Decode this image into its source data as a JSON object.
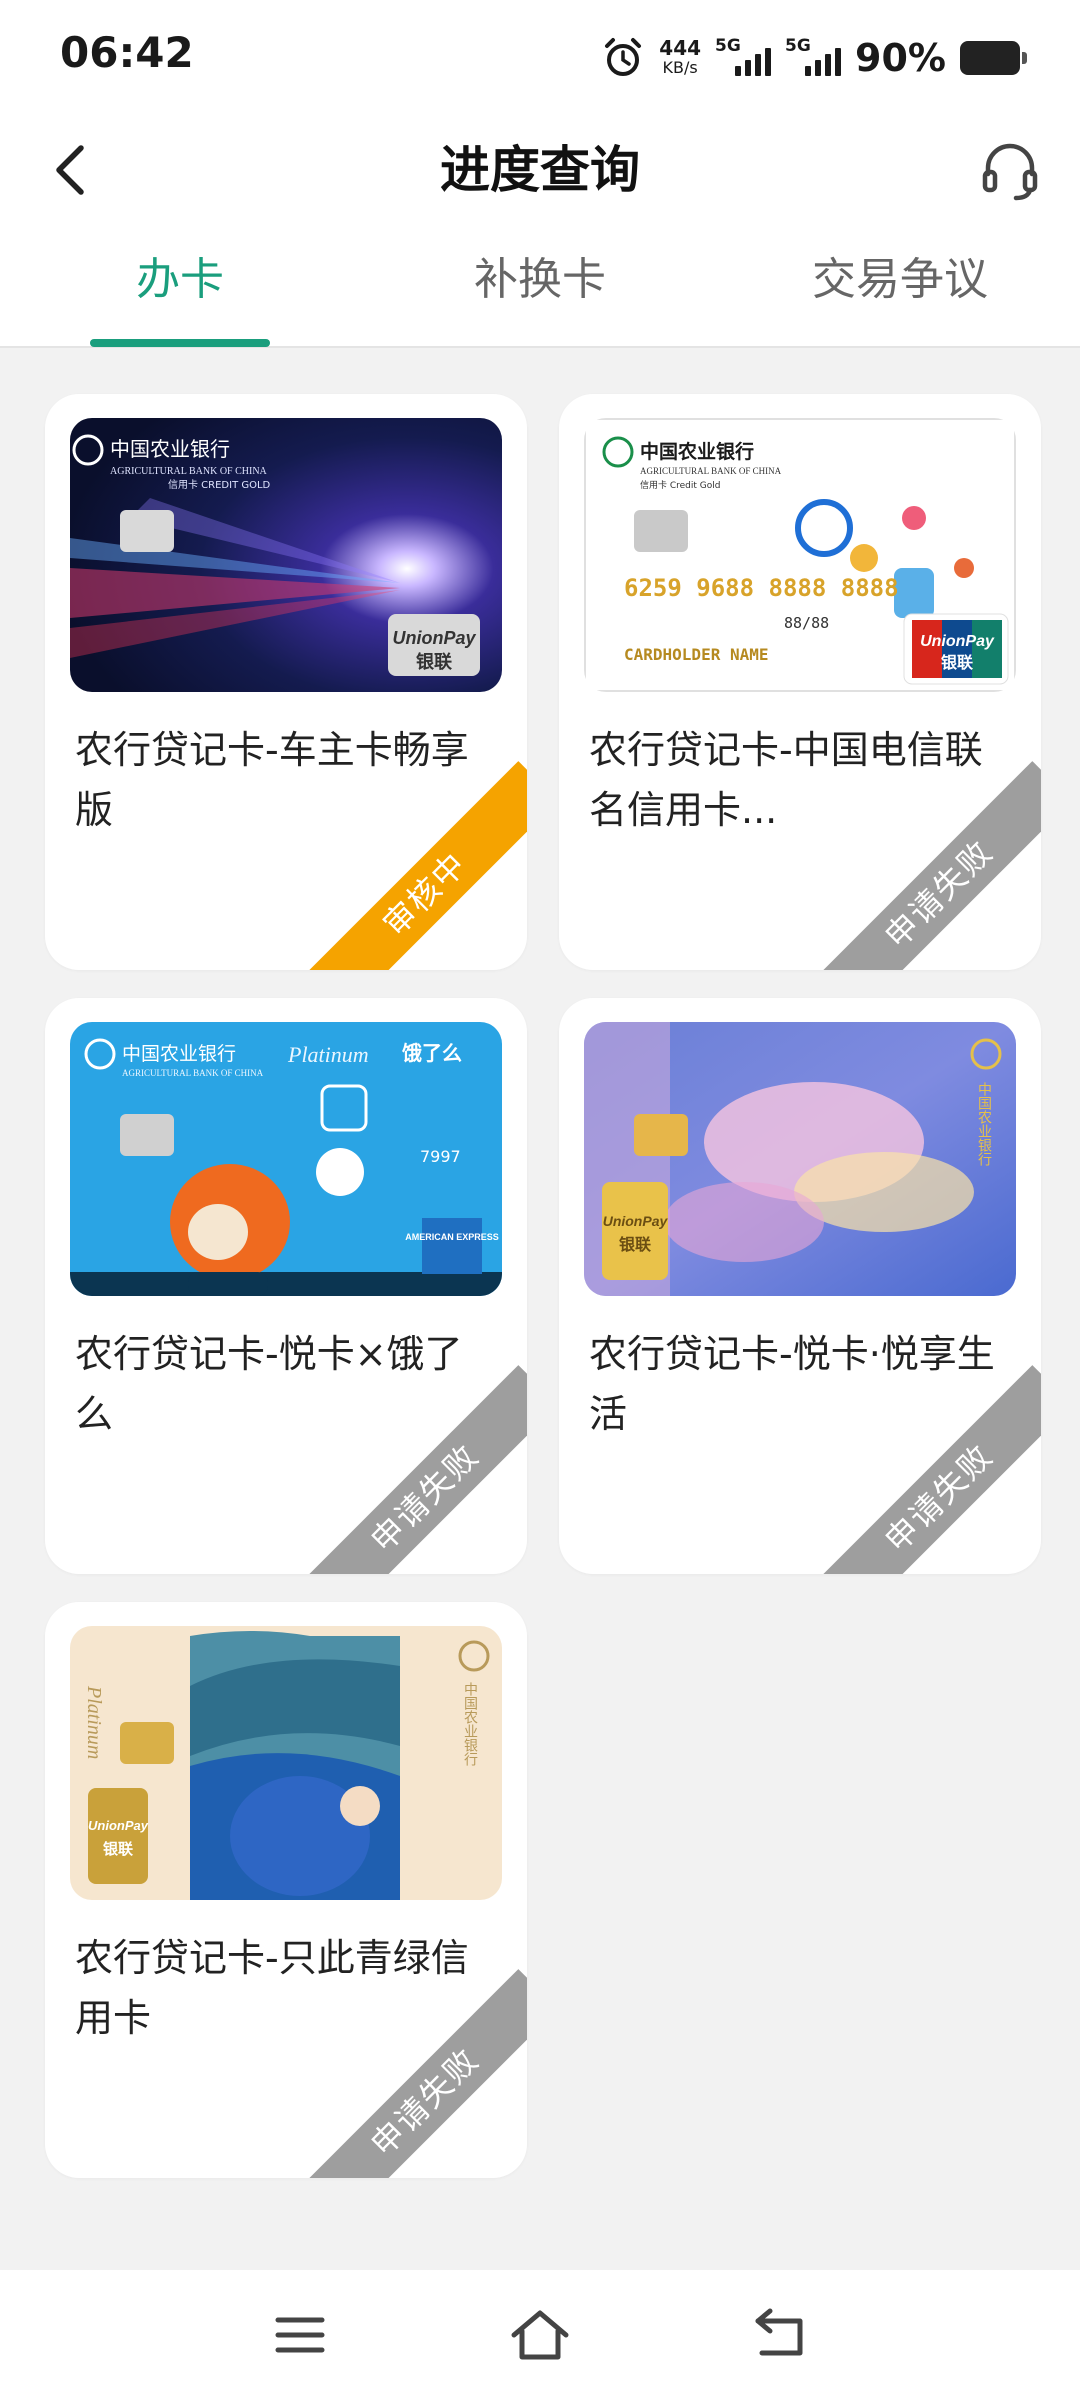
{
  "status_bar": {
    "time": "06:42",
    "net_speed_value": "444",
    "net_speed_unit": "KB/s",
    "sim1_tag": "5G",
    "sim2_tag": "5G",
    "battery": "90%"
  },
  "header": {
    "title": "进度查询",
    "back_icon": "chevron-left-icon",
    "service_icon": "headset-icon"
  },
  "tabs": [
    {
      "label": "办卡",
      "active": true
    },
    {
      "label": "补换卡",
      "active": false
    },
    {
      "label": "交易争议",
      "active": false
    }
  ],
  "colors": {
    "accent": "#1a9e7d",
    "status_reviewing": "#f5a300",
    "status_failed": "#9e9e9e",
    "card_bg": "#ffffff",
    "page_bg": "#f2f2f2"
  },
  "cards": [
    {
      "title": "农行贷记卡-车主卡畅享版",
      "status": "审核中",
      "status_type": "reviewing",
      "image": {
        "bank_name": "中国农业银行",
        "bank_name_en": "AGRICULTURAL BANK OF CHINA",
        "card_sub": "信用卡 CREDIT GOLD",
        "network_en": "UnionPay",
        "network_cn": "银联"
      }
    },
    {
      "title": "农行贷记卡-中国电信联名信用卡...",
      "status": "申请失败",
      "status_type": "failed",
      "image": {
        "bank_name": "中国农业银行",
        "bank_name_en": "AGRICULTURAL BANK OF CHINA",
        "card_sub": "信用卡 Credit Gold",
        "card_number": "6259 9688 8888 8888",
        "validity": "88/88",
        "holder": "CARDHOLDER NAME",
        "network_en": "UnionPay",
        "network_cn": "银联"
      }
    },
    {
      "title": "农行贷记卡-悦卡×饿了么",
      "status": "申请失败",
      "status_type": "failed",
      "image": {
        "bank_name": "中国农业银行",
        "bank_name_en": "AGRICULTURAL BANK OF CHINA",
        "tier": "Platinum",
        "partner": "饿了么",
        "number_tail": "7997",
        "network_en": "AMERICAN EXPRESS"
      }
    },
    {
      "title": "农行贷记卡-悦卡·悦享生活",
      "status": "申请失败",
      "status_type": "failed",
      "image": {
        "bank_name": "中国农业银行",
        "network_en": "UnionPay",
        "network_cn": "银联"
      }
    },
    {
      "title": "农行贷记卡-只此青绿信用卡",
      "status": "申请失败",
      "status_type": "failed",
      "image": {
        "bank_name": "中国农业银行",
        "tier": "Platinum",
        "network_en": "UnionPay",
        "network_cn": "银联"
      }
    }
  ],
  "bottom_nav": {
    "menu_icon": "menu-icon",
    "home_icon": "home-icon",
    "back_icon": "back-arrow-icon"
  }
}
